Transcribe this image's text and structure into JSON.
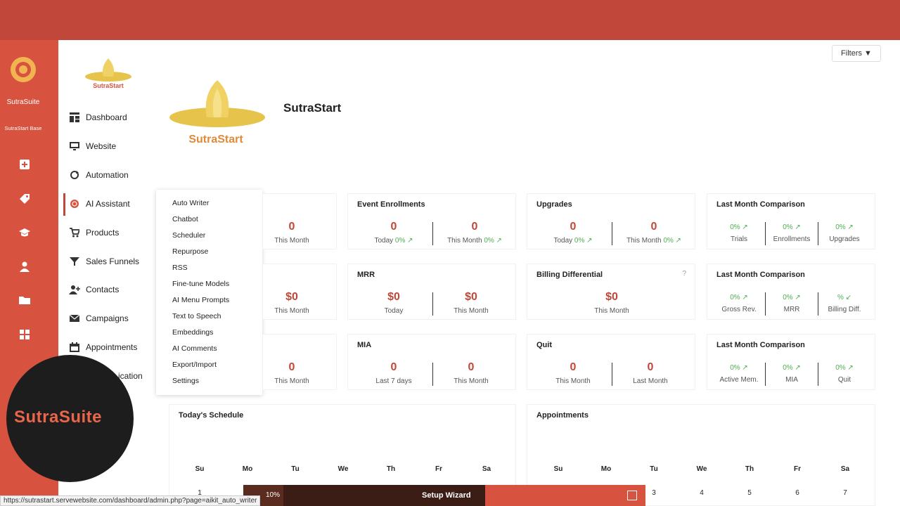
{
  "rail": {
    "brand": "SutraSuite",
    "sub": "SutraStart Base",
    "icons": [
      "add-box-icon",
      "tag-icon",
      "graduation-cap-icon",
      "user-icon",
      "folder-icon",
      "grid-icon"
    ]
  },
  "nav": {
    "items": [
      {
        "label": "Dashboard",
        "icon": "dashboard-icon"
      },
      {
        "label": "Website",
        "icon": "monitor-icon"
      },
      {
        "label": "Automation",
        "icon": "sync-icon"
      },
      {
        "label": "AI Assistant",
        "icon": "ai-icon"
      },
      {
        "label": "Products",
        "icon": "cart-icon"
      },
      {
        "label": "Sales Funnels",
        "icon": "funnel-icon"
      },
      {
        "label": "Contacts",
        "icon": "add-user-icon"
      },
      {
        "label": "Campaigns",
        "icon": "envelope-icon"
      },
      {
        "label": "Appointments",
        "icon": "calendar-icon"
      }
    ],
    "partial_item": "ication"
  },
  "submenu": {
    "items": [
      "Auto Writer",
      "Chatbot",
      "Scheduler",
      "Repurpose",
      "RSS",
      "Fine-tune Models",
      "AI Menu Prompts",
      "Text to Speech",
      "Embeddings",
      "AI Comments",
      "Export/Import",
      "Settings"
    ]
  },
  "header": {
    "filters_label": "Filters ▼",
    "title": "SutraStart",
    "logo_text": "SutraStart"
  },
  "cards": {
    "row1": {
      "c0": {
        "val": "0",
        "lbl": "This Month"
      },
      "event_enrollments": {
        "title": "Event Enrollments",
        "a_val": "0",
        "a_lbl": "Today",
        "a_pct": "0%",
        "b_val": "0",
        "b_lbl": "This Month",
        "b_pct": "0%"
      },
      "upgrades": {
        "title": "Upgrades",
        "a_val": "0",
        "a_lbl": "Today",
        "a_pct": "0%",
        "b_val": "0",
        "b_lbl": "This Month",
        "b_pct": "0%"
      },
      "comparison": {
        "title": "Last Month Comparison",
        "items": [
          {
            "pct": "0%",
            "lbl": "Trials"
          },
          {
            "pct": "0%",
            "lbl": "Enrollments"
          },
          {
            "pct": "0%",
            "lbl": "Upgrades"
          }
        ]
      }
    },
    "row2": {
      "c0": {
        "val": "$0",
        "lbl": "This Month"
      },
      "mrr": {
        "title": "MRR",
        "a_val": "$0",
        "a_lbl": "Today",
        "b_val": "$0",
        "b_lbl": "This Month"
      },
      "billing": {
        "title": "Billing Differential",
        "help": "?",
        "val": "$0",
        "lbl": "This Month"
      },
      "comparison": {
        "title": "Last Month Comparison",
        "items": [
          {
            "pct": "0%",
            "lbl": "Gross Rev."
          },
          {
            "pct": "0%",
            "lbl": "MRR"
          },
          {
            "pct": "%",
            "lbl": "Billing Diff."
          }
        ]
      }
    },
    "row3": {
      "c0": {
        "val": "0",
        "lbl": "This Month"
      },
      "mia": {
        "title": "MIA",
        "a_val": "0",
        "a_lbl": "Last 7 days",
        "b_val": "0",
        "b_lbl": "This Month"
      },
      "quit": {
        "title": "Quit",
        "a_val": "0",
        "a_lbl": "This Month",
        "b_val": "0",
        "b_lbl": "Last Month"
      },
      "comparison": {
        "title": "Last Month Comparison",
        "items": [
          {
            "pct": "0%",
            "lbl": "Active Mem."
          },
          {
            "pct": "0%",
            "lbl": "MIA"
          },
          {
            "pct": "0%",
            "lbl": "Quit"
          }
        ]
      }
    }
  },
  "schedule": {
    "title": "Today's Schedule",
    "days": [
      "Su",
      "Mo",
      "Tu",
      "We",
      "Th",
      "Fr",
      "Sa"
    ],
    "first": "1"
  },
  "appointments": {
    "title": "Appointments",
    "days": [
      "Su",
      "Mo",
      "Tu",
      "We",
      "Th",
      "Fr",
      "Sa"
    ],
    "nums": [
      "3",
      "4",
      "5",
      "6",
      "7"
    ]
  },
  "wizard": {
    "label": "Setup Wizard",
    "pct": "10%",
    "progress": 0.1
  },
  "status_url": "https://sutrastart.servewebsite.com/dashboard/admin.php?page=aikit_auto_writer",
  "badge": {
    "text": "SutraSuite"
  },
  "colors": {
    "accent": "#c0473a",
    "rail": "#d8533f",
    "positive": "#4caf50"
  }
}
